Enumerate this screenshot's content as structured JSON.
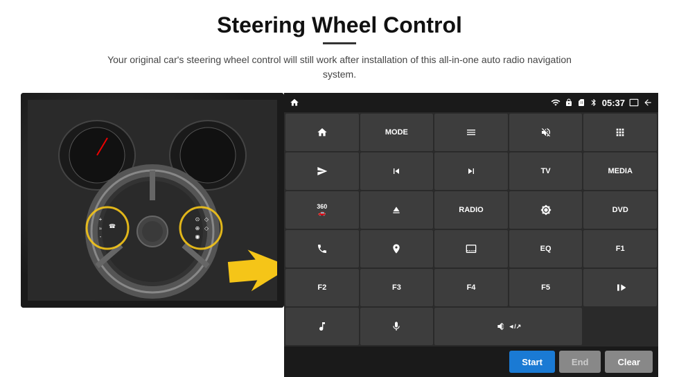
{
  "header": {
    "title": "Steering Wheel Control",
    "subtitle": "Your original car's steering wheel control will still work after installation of this all-in-one auto radio navigation system."
  },
  "statusBar": {
    "time": "05:37",
    "icons": [
      "wifi",
      "lock",
      "sim",
      "bluetooth",
      "screen",
      "back"
    ]
  },
  "buttons": [
    {
      "id": "home",
      "type": "icon",
      "icon": "home"
    },
    {
      "id": "mode",
      "type": "text",
      "label": "MODE"
    },
    {
      "id": "list",
      "type": "icon",
      "icon": "list"
    },
    {
      "id": "mute",
      "type": "icon",
      "icon": "mute"
    },
    {
      "id": "apps",
      "type": "icon",
      "icon": "apps"
    },
    {
      "id": "send",
      "type": "icon",
      "icon": "send"
    },
    {
      "id": "prev",
      "type": "icon",
      "icon": "prev"
    },
    {
      "id": "next",
      "type": "icon",
      "icon": "next"
    },
    {
      "id": "tv",
      "type": "text",
      "label": "TV"
    },
    {
      "id": "media",
      "type": "text",
      "label": "MEDIA"
    },
    {
      "id": "360",
      "type": "icon",
      "icon": "360"
    },
    {
      "id": "eject",
      "type": "icon",
      "icon": "eject"
    },
    {
      "id": "radio",
      "type": "text",
      "label": "RADIO"
    },
    {
      "id": "brightness",
      "type": "icon",
      "icon": "brightness"
    },
    {
      "id": "dvd",
      "type": "text",
      "label": "DVD"
    },
    {
      "id": "phone",
      "type": "icon",
      "icon": "phone"
    },
    {
      "id": "navi",
      "type": "icon",
      "icon": "navi"
    },
    {
      "id": "screen2",
      "type": "icon",
      "icon": "screen2"
    },
    {
      "id": "eq",
      "type": "text",
      "label": "EQ"
    },
    {
      "id": "f1",
      "type": "text",
      "label": "F1"
    },
    {
      "id": "f2",
      "type": "text",
      "label": "F2"
    },
    {
      "id": "f3",
      "type": "text",
      "label": "F3"
    },
    {
      "id": "f4",
      "type": "text",
      "label": "F4"
    },
    {
      "id": "f5",
      "type": "text",
      "label": "F5"
    },
    {
      "id": "playpause",
      "type": "icon",
      "icon": "playpause"
    },
    {
      "id": "music",
      "type": "icon",
      "icon": "music"
    },
    {
      "id": "mic",
      "type": "icon",
      "icon": "mic"
    },
    {
      "id": "vol",
      "type": "icon",
      "icon": "vol",
      "span": 2
    }
  ],
  "actions": {
    "start": "Start",
    "end": "End",
    "clear": "Clear"
  }
}
